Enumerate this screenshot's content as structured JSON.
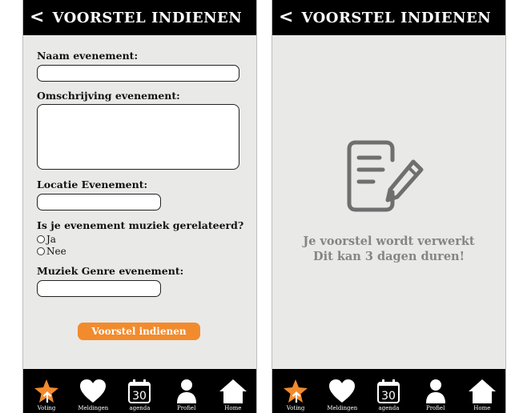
{
  "header": {
    "back_icon": "chevron-left-icon",
    "back_glyph": "<",
    "title": "VOORSTEL INDIENEN"
  },
  "form": {
    "name_label": "Naam evenement:",
    "name_value": "",
    "description_label": "Omschrijving evenement:",
    "description_value": "",
    "location_label": "Locatie Evenement:",
    "location_value": "",
    "music_question": "Is je evenement muziek gerelateerd?",
    "music_options": [
      "Ja",
      "Nee"
    ],
    "genre_label": "Muziek Genre evenement:",
    "genre_value": "",
    "submit_label": "Voorstel indienen"
  },
  "confirmation": {
    "icon": "document-edit-icon",
    "line1": "Je voorstel wordt verwerkt",
    "line2": "Dit kan 3 dagen duren!"
  },
  "nav": {
    "items": [
      {
        "label": "Voting",
        "icon": "star-arrow-icon"
      },
      {
        "label": "Meldingen",
        "icon": "heart-icon"
      },
      {
        "label": "agenda",
        "icon": "calendar-icon",
        "day": "30"
      },
      {
        "label": "Profiel",
        "icon": "person-icon"
      },
      {
        "label": "Home",
        "icon": "home-icon"
      }
    ]
  },
  "colors": {
    "accent": "#f28b2d",
    "header_bg": "#000000",
    "screen_bg": "#e9e9e7",
    "muted_text": "#858585"
  }
}
